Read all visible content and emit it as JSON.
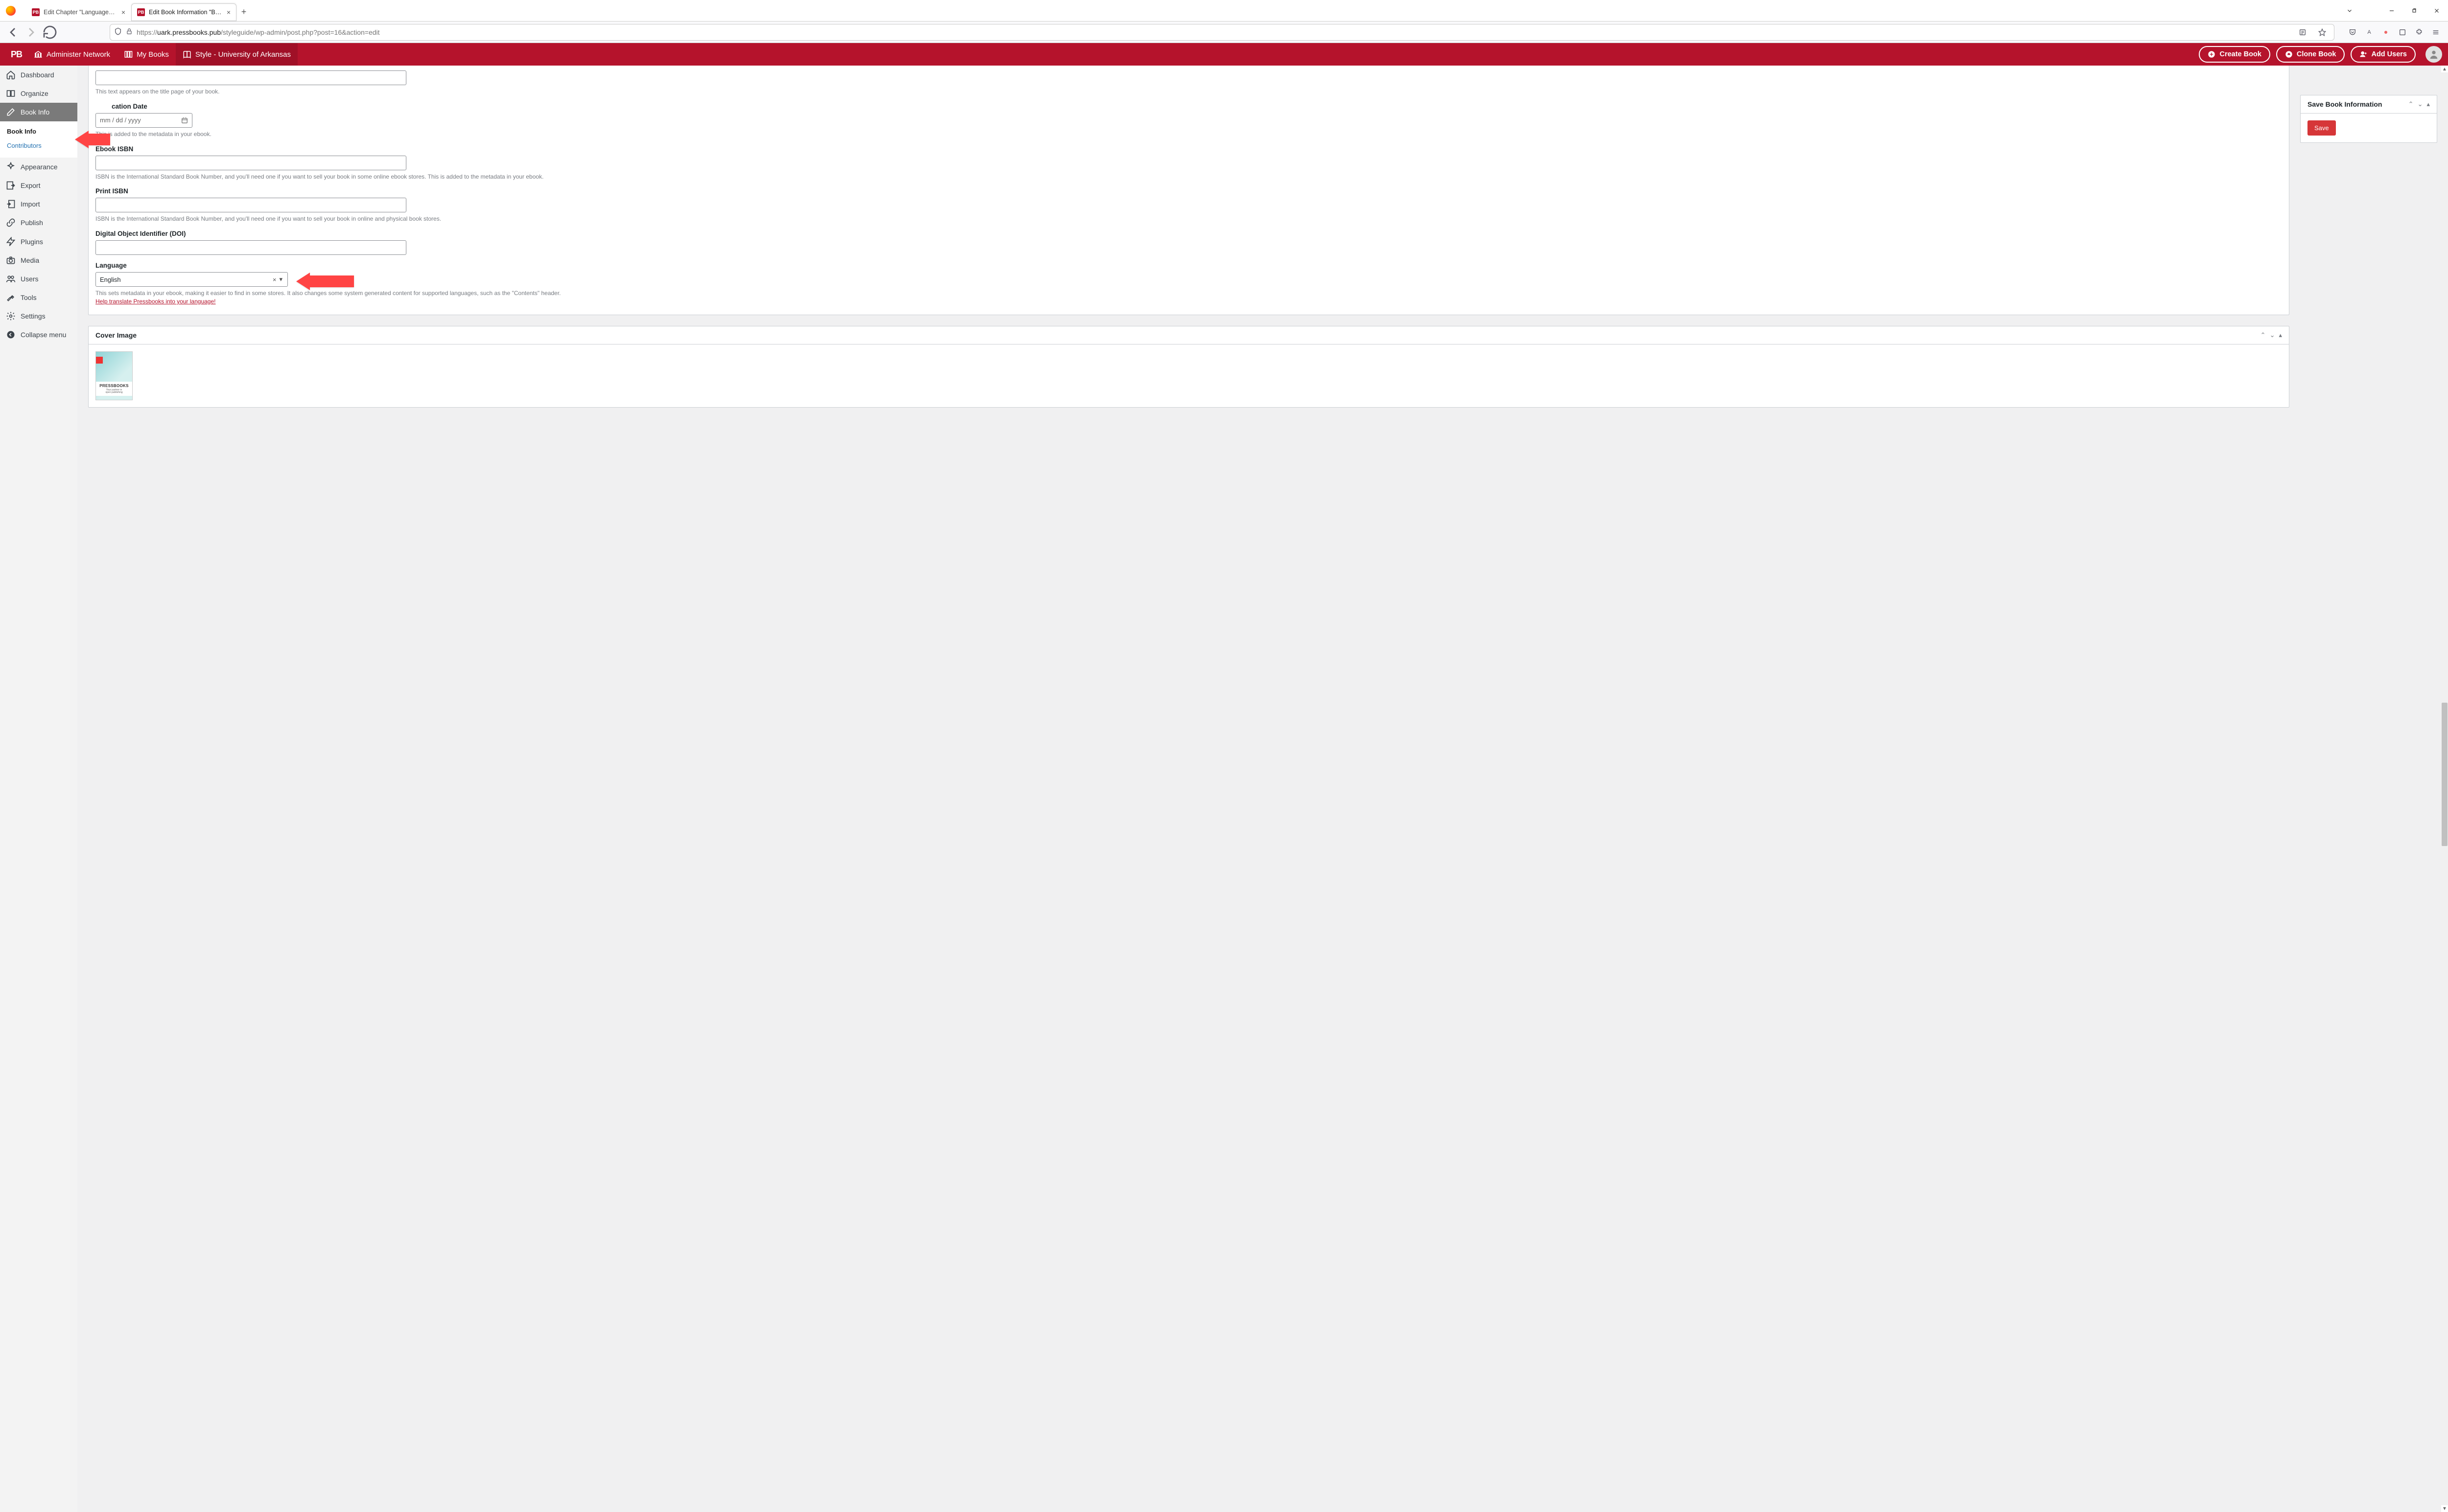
{
  "browser": {
    "tabs": [
      {
        "title": "Edit Chapter \"Languages\" ‹ Styl",
        "active": false
      },
      {
        "title": "Edit Book Information \"Book Inf",
        "active": true
      }
    ],
    "url_prefix": "https://",
    "url_host": "uark.pressbooks.pub",
    "url_path": "/styleguide/wp-admin/post.php?post=16&action=edit"
  },
  "pbbar": {
    "logo": "PB",
    "items": [
      {
        "label": "Administer Network"
      },
      {
        "label": "My Books"
      },
      {
        "label": "Style - University of Arkansas"
      }
    ],
    "buttons": {
      "create": "Create Book",
      "clone": "Clone Book",
      "addusers": "Add Users"
    }
  },
  "sidebar": {
    "items": [
      {
        "key": "dashboard",
        "label": "Dashboard"
      },
      {
        "key": "organize",
        "label": "Organize"
      },
      {
        "key": "bookinfo",
        "label": "Book Info",
        "current": true
      },
      {
        "key": "appearance",
        "label": "Appearance"
      },
      {
        "key": "export",
        "label": "Export"
      },
      {
        "key": "import",
        "label": "Import"
      },
      {
        "key": "publish",
        "label": "Publish"
      },
      {
        "key": "plugins",
        "label": "Plugins"
      },
      {
        "key": "media",
        "label": "Media"
      },
      {
        "key": "users",
        "label": "Users"
      },
      {
        "key": "tools",
        "label": "Tools"
      },
      {
        "key": "settings",
        "label": "Settings"
      },
      {
        "key": "collapse",
        "label": "Collapse menu"
      }
    ],
    "sub": {
      "bookinfo": "Book Info",
      "contributors": "Contributors"
    }
  },
  "form": {
    "titlepage_hint": "This text appears on the title page of your book.",
    "pubdate_label": "Publication Date",
    "pubdate_placeholder": "mm / dd / yyyy",
    "pubdate_hint": "This is added to the metadata in your ebook.",
    "ebook_isbn_label": "Ebook ISBN",
    "ebook_isbn_hint": "ISBN is the International Standard Book Number, and you'll need one if you want to sell your book in some online ebook stores. This is added to the metadata in your ebook.",
    "print_isbn_label": "Print ISBN",
    "print_isbn_hint": "ISBN is the International Standard Book Number, and you'll need one if you want to sell your book in online and physical book stores.",
    "doi_label": "Digital Object Identifier (DOI)",
    "language_label": "Language",
    "language_value": "English",
    "language_hint": "This sets metadata in your ebook, making it easier to find in some stores. It also changes some system generated content for supported languages, such as the \"Contents\" header.",
    "language_link": "Help translate Pressbooks into your language!",
    "cover_label": "Cover Image",
    "cover_brand": "PRESSBOOKS",
    "cover_tag1": "Your partner in",
    "cover_tag2": "open publishing"
  },
  "savebox": {
    "title": "Save Book Information",
    "button": "Save"
  }
}
